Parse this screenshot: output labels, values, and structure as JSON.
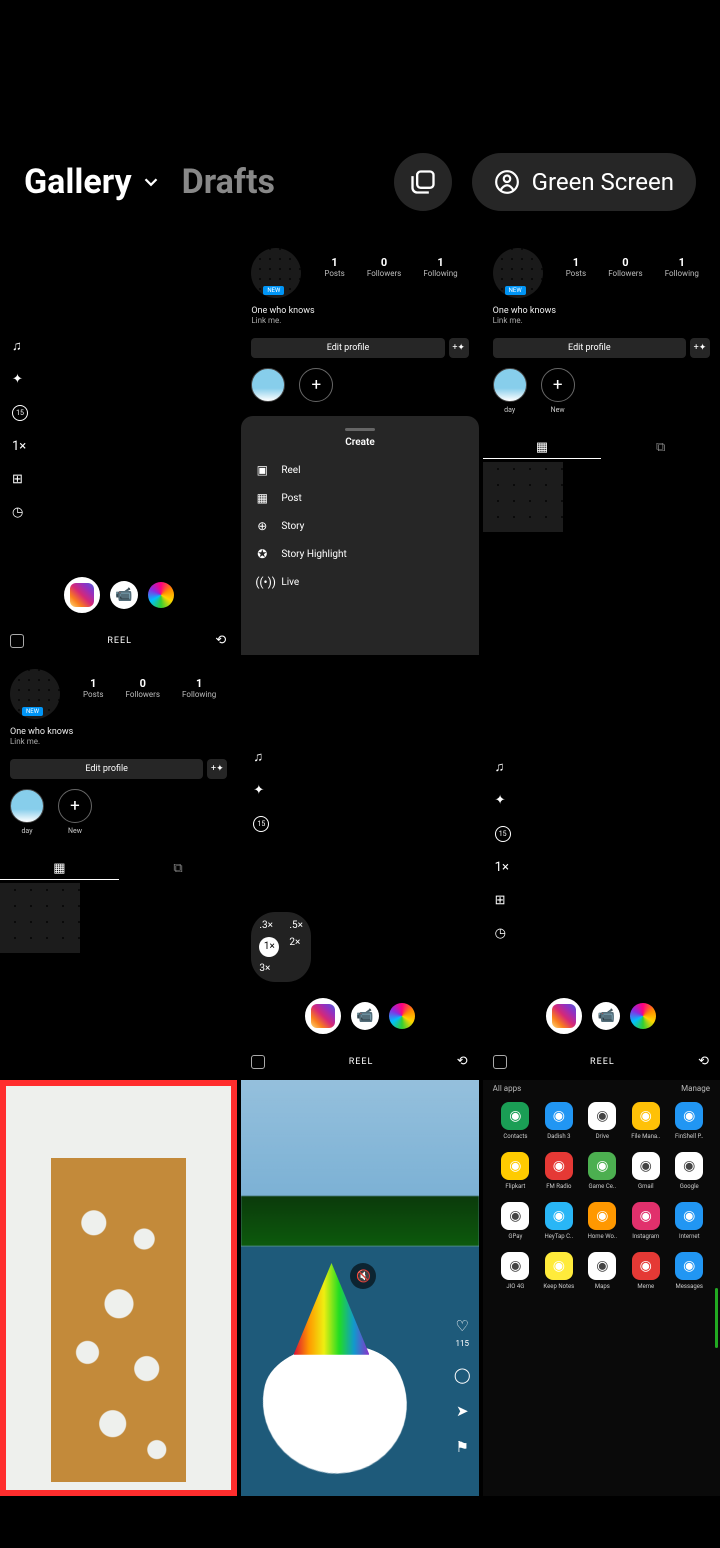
{
  "header": {
    "tabs": {
      "gallery": "Gallery",
      "drafts": "Drafts"
    },
    "green_screen": "Green Screen"
  },
  "reel": {
    "label": "REEL",
    "speed": "1×",
    "timer": "15"
  },
  "zoom": {
    "a": ".3×",
    "b": ".5×",
    "c": "1×",
    "d": "2×",
    "e": "3×"
  },
  "profile": {
    "posts_n": "1",
    "posts_l": "Posts",
    "followers_n": "0",
    "followers_l": "Followers",
    "following_n": "1",
    "following_l": "Following",
    "bio": "One who knows",
    "link": "Link me.",
    "edit": "Edit profile",
    "badge": "NEW",
    "story_day": "day",
    "story_new": "New"
  },
  "create": {
    "title": "Create",
    "reel": "Reel",
    "post": "Post",
    "story": "Story",
    "highlight": "Story Highlight",
    "live": "Live"
  },
  "feed": {
    "likes": "115"
  },
  "drawer": {
    "all": "All apps",
    "manage": "Manage",
    "apps": [
      {
        "n": "Contacts",
        "c": "#1a9e55"
      },
      {
        "n": "Dadish 3",
        "c": "#2196f3"
      },
      {
        "n": "Drive",
        "c": "#ffffff"
      },
      {
        "n": "File Mana..",
        "c": "#ffc107"
      },
      {
        "n": "FinShell P..",
        "c": "#2196f3"
      },
      {
        "n": "Flipkart",
        "c": "#ffcb00"
      },
      {
        "n": "FM Radio",
        "c": "#e53935"
      },
      {
        "n": "Game Ce..",
        "c": "#4caf50"
      },
      {
        "n": "Gmail",
        "c": "#ffffff"
      },
      {
        "n": "Google",
        "c": "#ffffff"
      },
      {
        "n": "GPay",
        "c": "#ffffff"
      },
      {
        "n": "HeyTap C..",
        "c": "#29b6f6"
      },
      {
        "n": "Home Wo..",
        "c": "#ff9800"
      },
      {
        "n": "Instagram",
        "c": "#e1306c"
      },
      {
        "n": "Internet",
        "c": "#2196f3"
      },
      {
        "n": "JIO 4G",
        "c": "#ffffff"
      },
      {
        "n": "Keep Notes",
        "c": "#ffeb3b"
      },
      {
        "n": "Maps",
        "c": "#ffffff"
      },
      {
        "n": "Meme",
        "c": "#e53935"
      },
      {
        "n": "Messages",
        "c": "#2196f3"
      }
    ]
  }
}
